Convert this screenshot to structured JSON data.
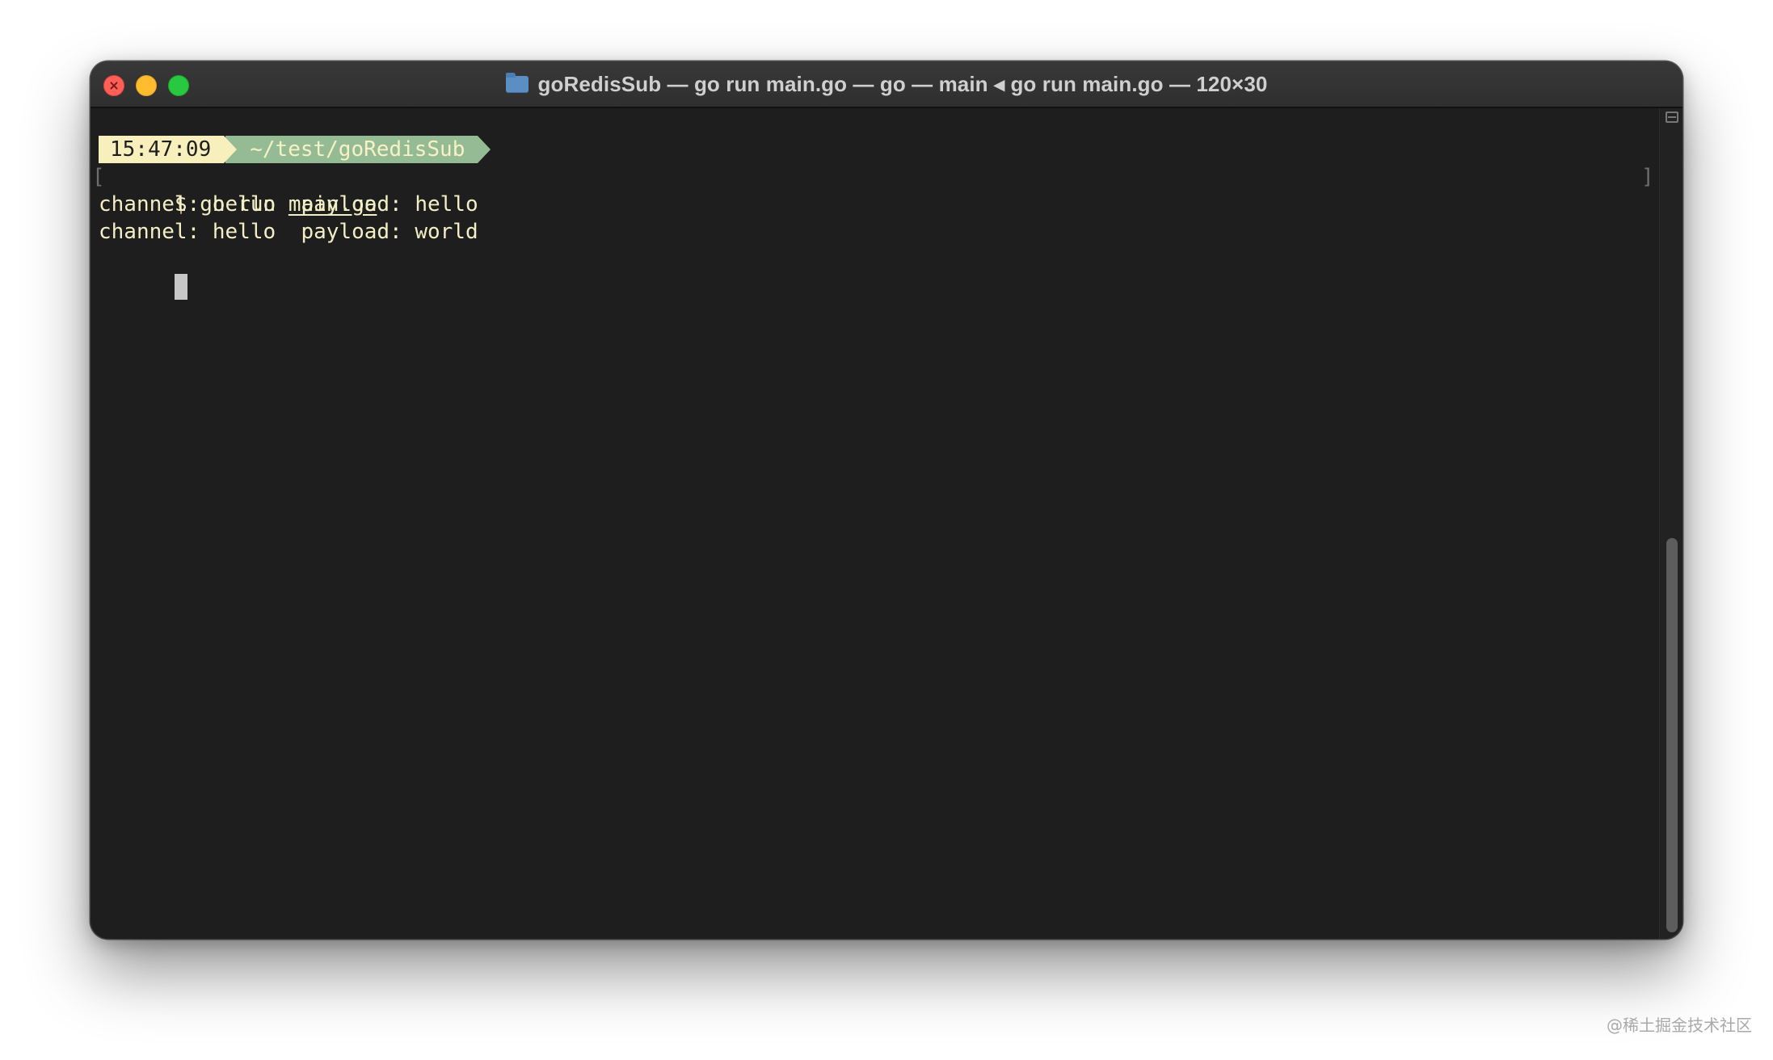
{
  "window": {
    "title": "goRedisSub — go run main.go — go — main ◂ go run main.go — 120×30"
  },
  "terminal": {
    "prompt": {
      "time": "15:47:09",
      "path": "~/test/goRedisSub"
    },
    "command": {
      "symbol": "$",
      "text": "go run",
      "arg": "main.go"
    },
    "output": [
      "channel: hello  payload: hello",
      "channel: hello  payload: world"
    ],
    "bracket_left": "[",
    "bracket_right": "]"
  },
  "watermark": "@稀土掘金技术社区",
  "colors": {
    "terminal_bg": "#1e1e1e",
    "prompt_time_bg": "#f7f0bd",
    "prompt_path_bg": "#94bb93",
    "text": "#f3efc4"
  },
  "icons": {
    "title": "folder-icon",
    "scroll": "split-pane-icon"
  }
}
